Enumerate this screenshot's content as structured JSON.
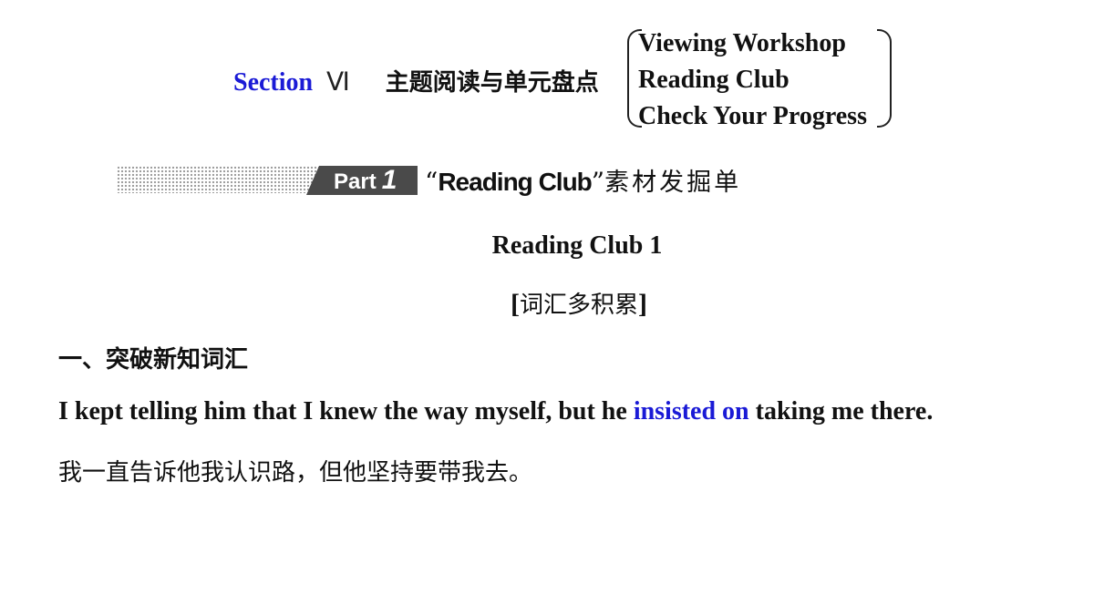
{
  "title": {
    "section": "Section",
    "roman": "Ⅵ",
    "chinese": "主题阅读与单元盘点",
    "items": [
      "Viewing Workshop",
      "Reading Club",
      "Check Your Progress"
    ]
  },
  "banner": {
    "part_label": "Part",
    "part_number": "1",
    "open_quote": "“",
    "title_en": "Reading Club",
    "close_quote": "”",
    "title_cn": "素材发掘单"
  },
  "subtitle": "Reading Club 1",
  "vocab": {
    "open": "[",
    "text": "词汇多积累",
    "close": "]"
  },
  "section_heading": "一、突破新知词汇",
  "example": {
    "before": "I kept telling him that I knew the way myself, but he ",
    "highlight": "insisted on",
    "after": " taking me there.",
    "highlight_color": "#1a1ad6"
  },
  "translation": "我一直告诉他我认识路，但他坚持要带我去。"
}
